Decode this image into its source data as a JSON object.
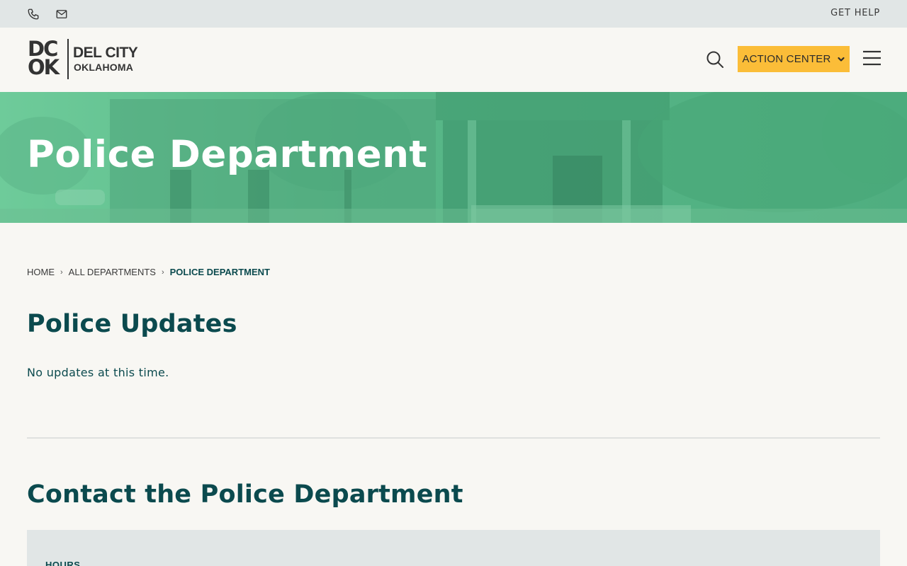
{
  "utility_bar": {
    "phone_icon": "phone-icon",
    "email_icon": "envelope-icon",
    "get_help": "GET HELP"
  },
  "header": {
    "logo_mark_top": "DC",
    "logo_mark_bottom": "OK",
    "logo_name": "DEL CITY",
    "logo_state": "OKLAHOMA",
    "search_icon": "search-icon",
    "action_center_label": "ACTION CENTER",
    "menu_icon": "hamburger-icon"
  },
  "hero": {
    "title": "Police Department"
  },
  "breadcrumb": {
    "home": "HOME",
    "departments": "ALL DEPARTMENTS",
    "current": "POLICE DEPARTMENT"
  },
  "updates": {
    "heading": "Police Updates",
    "text": "No updates at this time."
  },
  "contact": {
    "heading": "Contact the Police Department",
    "hours_label": "HOURS"
  },
  "colors": {
    "accent": "#fbbd38",
    "hero_green": "#58b888",
    "heading": "#0b4a4e",
    "utility_bg": "#e1e6e6",
    "page_bg": "#f8f7f3"
  }
}
